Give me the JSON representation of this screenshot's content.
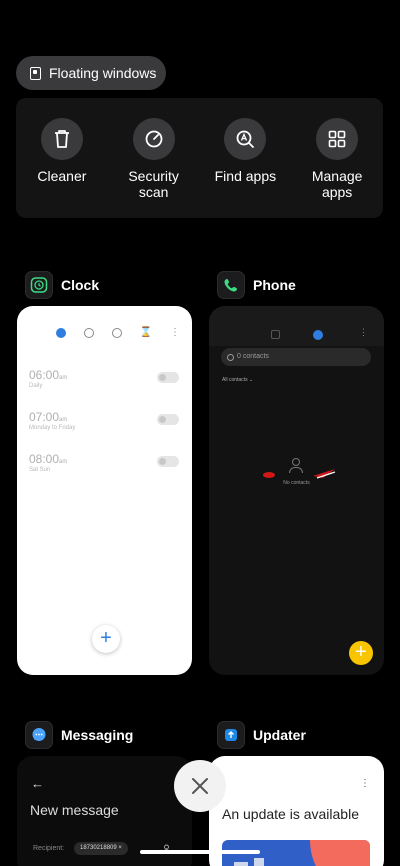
{
  "floating_windows": {
    "label": "Floating windows",
    "icon": "floating-window-icon"
  },
  "tools": [
    {
      "label": "Cleaner",
      "icon": "trash-icon"
    },
    {
      "label": "Security\nscan",
      "icon": "shield-speedometer-icon"
    },
    {
      "label": "Find apps",
      "icon": "search-apps-icon"
    },
    {
      "label": "Manage\napps",
      "icon": "grid-icon"
    }
  ],
  "apps": {
    "clock": {
      "name": "Clock",
      "icon": "clock-icon",
      "alarms": [
        {
          "time": "06:00",
          "ampm": "am",
          "days": "Daily"
        },
        {
          "time": "07:00",
          "ampm": "am",
          "days": "Monday to Friday"
        },
        {
          "time": "08:00",
          "ampm": "am",
          "days": "Sat Sun"
        }
      ],
      "add_label": "+"
    },
    "phone": {
      "name": "Phone",
      "icon": "phone-icon",
      "search_placeholder": "0 contacts",
      "filter_label": "All contacts",
      "empty_label": "No contacts",
      "add_label": "+"
    },
    "messaging": {
      "name": "Messaging",
      "icon": "chat-bubble-icon",
      "back": "←",
      "title": "New message",
      "recipient_label": "Recipient:",
      "recipient_value": "18730218809"
    },
    "updater": {
      "name": "Updater",
      "icon": "update-icon",
      "menu": "⋮",
      "headline": "An update is available"
    }
  },
  "close_label": "✕",
  "colors": {
    "accent_blue": "#2f7de1",
    "phone_fab": "#f9c400",
    "background": "#000000"
  }
}
